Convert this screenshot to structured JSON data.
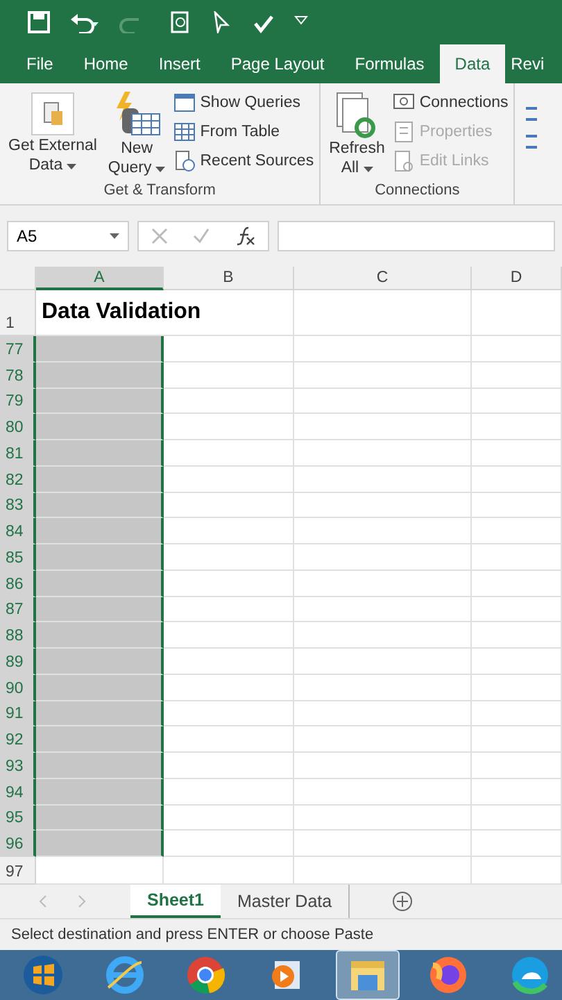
{
  "quick_access": {
    "redo_disabled": true
  },
  "tabs": [
    {
      "label": "File",
      "selected": false
    },
    {
      "label": "Home",
      "selected": false
    },
    {
      "label": "Insert",
      "selected": false
    },
    {
      "label": "Page Layout",
      "selected": false
    },
    {
      "label": "Formulas",
      "selected": false
    },
    {
      "label": "Data",
      "selected": true
    },
    {
      "label": "Revi",
      "selected": false
    }
  ],
  "ribbon": {
    "groups": [
      {
        "label": "Get & Transform",
        "large": [
          {
            "label_1": "Get External",
            "label_2": "Data",
            "kind": "external"
          },
          {
            "label_1": "New",
            "label_2": "Query",
            "kind": "query"
          }
        ],
        "small": [
          {
            "label": "Show Queries",
            "disabled": false,
            "kind": "table"
          },
          {
            "label": "From Table",
            "disabled": false,
            "kind": "grid"
          },
          {
            "label": "Recent Sources",
            "disabled": false,
            "kind": "recent"
          }
        ]
      },
      {
        "label": "Connections",
        "large": [
          {
            "label_1": "Refresh",
            "label_2": "All",
            "kind": "refresh"
          }
        ],
        "small": [
          {
            "label": "Connections",
            "disabled": false,
            "kind": "connections"
          },
          {
            "label": "Properties",
            "disabled": true,
            "kind": "properties"
          },
          {
            "label": "Edit Links",
            "disabled": true,
            "kind": "links"
          }
        ]
      }
    ]
  },
  "formula_bar": {
    "name_box": "A5"
  },
  "columns": [
    {
      "label": "A",
      "selected": true
    },
    {
      "label": "B",
      "selected": false
    },
    {
      "label": "C",
      "selected": false
    },
    {
      "label": "D",
      "selected": false
    }
  ],
  "rows": [
    {
      "number": "1",
      "selected": false,
      "cell_a": "Data Validation"
    },
    {
      "number": "77",
      "selected": true
    },
    {
      "number": "78",
      "selected": true
    },
    {
      "number": "79",
      "selected": true
    },
    {
      "number": "80",
      "selected": true
    },
    {
      "number": "81",
      "selected": true
    },
    {
      "number": "82",
      "selected": true
    },
    {
      "number": "83",
      "selected": true
    },
    {
      "number": "84",
      "selected": true
    },
    {
      "number": "85",
      "selected": true
    },
    {
      "number": "86",
      "selected": true
    },
    {
      "number": "87",
      "selected": true
    },
    {
      "number": "88",
      "selected": true
    },
    {
      "number": "89",
      "selected": true
    },
    {
      "number": "90",
      "selected": true
    },
    {
      "number": "91",
      "selected": true
    },
    {
      "number": "92",
      "selected": true
    },
    {
      "number": "93",
      "selected": true
    },
    {
      "number": "94",
      "selected": true
    },
    {
      "number": "95",
      "selected": true
    },
    {
      "number": "96",
      "selected": true
    },
    {
      "number": "97",
      "selected": false
    }
  ],
  "sheet_tabs": [
    {
      "label": "Sheet1",
      "selected": true
    },
    {
      "label": "Master Data",
      "selected": false
    }
  ],
  "status_bar": "Select destination and press ENTER or choose Paste",
  "taskbar": [
    {
      "kind": "start",
      "selected": false
    },
    {
      "kind": "browser-e",
      "selected": false
    },
    {
      "kind": "chrome",
      "selected": false
    },
    {
      "kind": "media",
      "selected": false
    },
    {
      "kind": "folder",
      "selected": true
    },
    {
      "kind": "fox",
      "selected": false
    },
    {
      "kind": "edge",
      "selected": false
    }
  ]
}
